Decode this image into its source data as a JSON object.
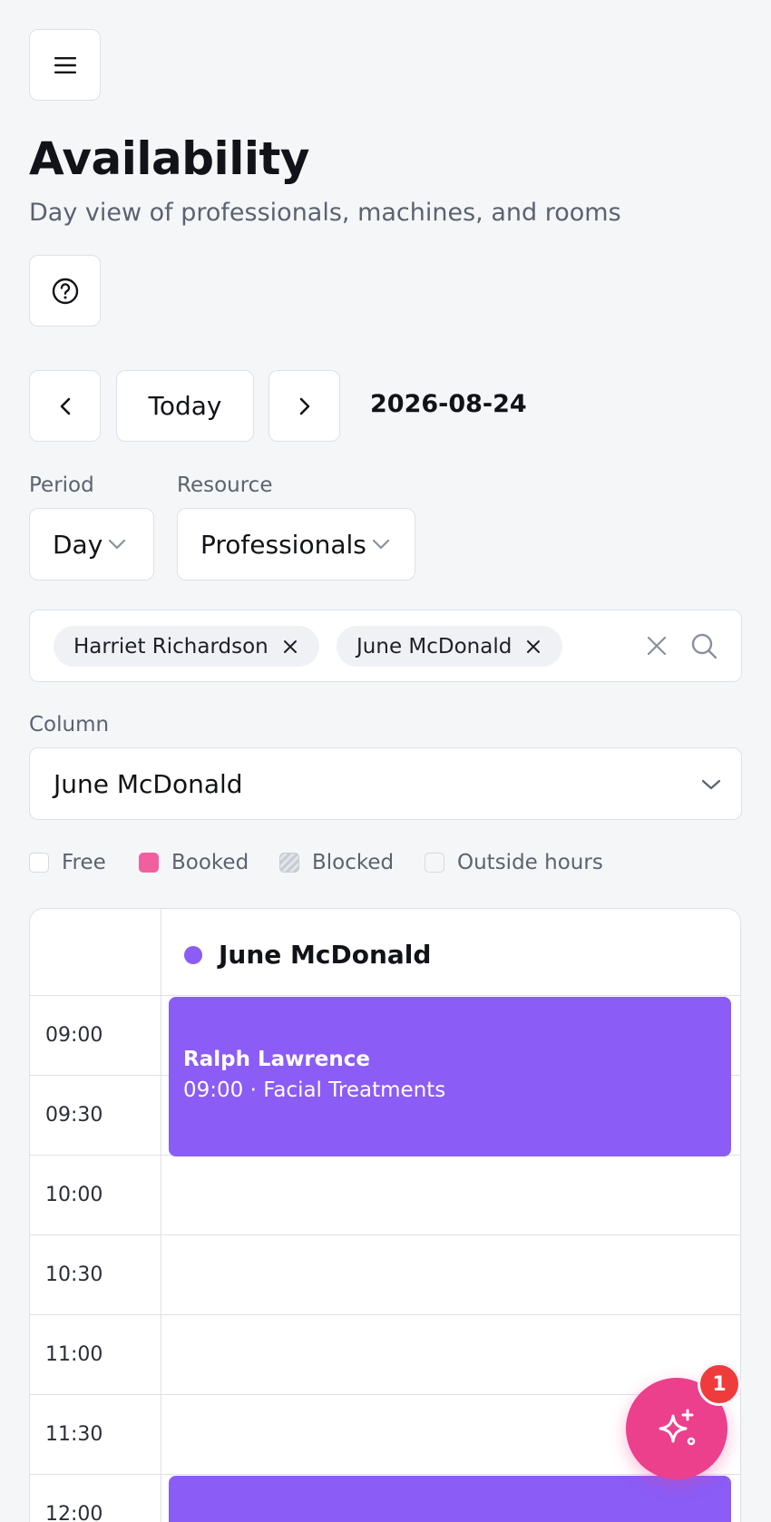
{
  "header": {
    "title": "Availability",
    "subtitle": "Day view of professionals, machines, and rooms"
  },
  "icons": {
    "menu": "menu-icon",
    "help": "help-circle-icon",
    "prev": "chevron-left-icon",
    "next": "chevron-right-icon",
    "chevron": "chevron-down-icon",
    "remove": "close-icon",
    "clear": "close-icon",
    "search": "search-icon",
    "assistant": "sparkles-icon"
  },
  "date_nav": {
    "today_label": "Today",
    "current_date": "2026-08-24"
  },
  "filters": {
    "period_label": "Period",
    "period_value": "Day",
    "resource_label": "Resource",
    "resource_value": "Professionals",
    "selected_chips": [
      "Harriet Richardson",
      "June McDonald"
    ],
    "column_label": "Column",
    "column_value": "June McDonald"
  },
  "legend": [
    {
      "label": "Free",
      "color": "#ffffff"
    },
    {
      "label": "Booked",
      "color": "#f0609e"
    },
    {
      "label": "Blocked",
      "color": "#c8ccd3"
    },
    {
      "label": "Outside hours",
      "color": "#f5f6f8"
    }
  ],
  "calendar": {
    "column_name": "June McDonald",
    "column_color": "#8b5cf6",
    "time_slots": [
      "09:00",
      "09:30",
      "10:00",
      "10:30",
      "11:00",
      "11:30",
      "12:00"
    ],
    "events": [
      {
        "client": "Ralph Lawrence",
        "detail": "09:00 · Facial Treatments",
        "start": "09:00",
        "end": "10:00",
        "color": "#8b5cf6"
      },
      {
        "client": "",
        "detail": "",
        "start": "12:00",
        "end": "12:30",
        "color": "#8b5cf6"
      }
    ]
  },
  "fab": {
    "badge_count": "1",
    "color": "#ec3f8c"
  }
}
